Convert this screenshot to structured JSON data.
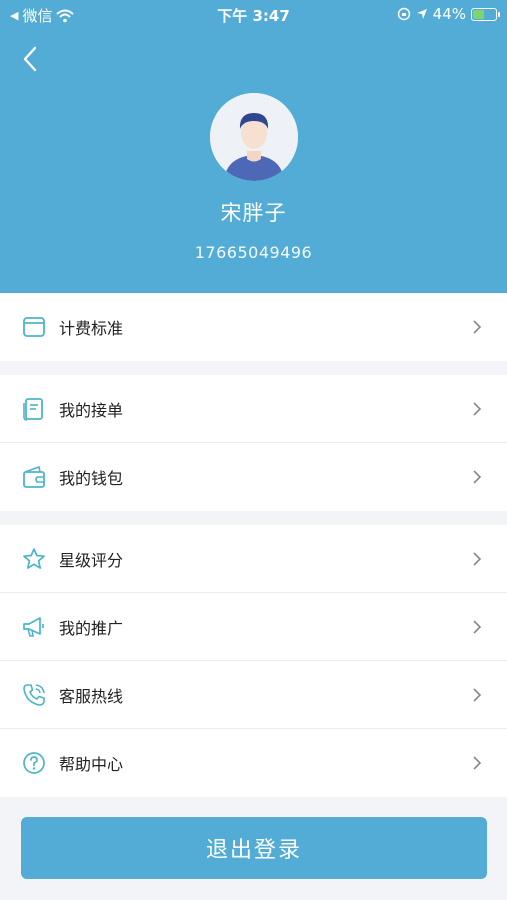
{
  "status_bar": {
    "carrier": "微信",
    "time": "下午 3:47",
    "battery": "44%"
  },
  "profile": {
    "name": "宋胖子",
    "phone": "17665049496"
  },
  "menu_groups": [
    [
      {
        "label": "计费标准",
        "icon": "billing-icon"
      }
    ],
    [
      {
        "label": "我的接单",
        "icon": "orders-icon"
      },
      {
        "label": "我的钱包",
        "icon": "wallet-icon"
      }
    ],
    [
      {
        "label": "星级评分",
        "icon": "star-icon"
      },
      {
        "label": "我的推广",
        "icon": "megaphone-icon"
      },
      {
        "label": "客服热线",
        "icon": "phone-icon"
      },
      {
        "label": "帮助中心",
        "icon": "help-icon"
      }
    ]
  ],
  "logout_label": "退出登录",
  "colors": {
    "primary": "#52acd6",
    "icon": "#4bb6c9"
  }
}
